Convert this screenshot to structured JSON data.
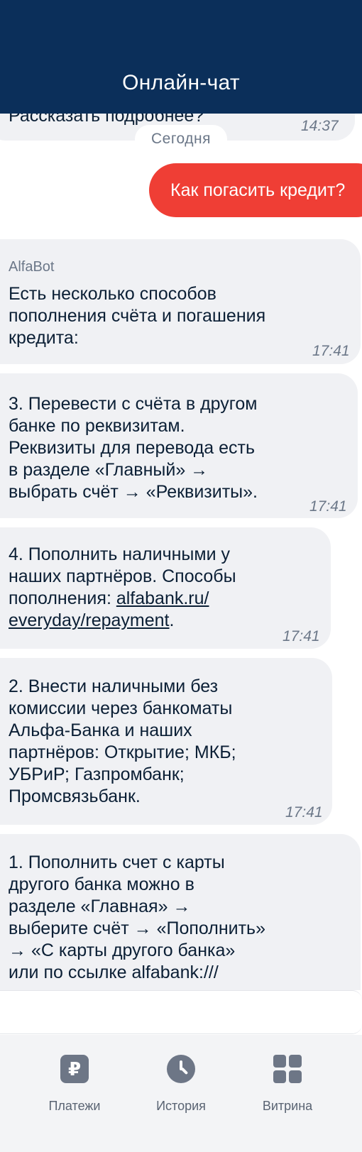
{
  "header": {
    "title": "Онлайн-чат"
  },
  "chat": {
    "prev_message": {
      "text": "Рассказать подробнее?",
      "time": "14:37"
    },
    "date_divider": "Сегодня",
    "user_message": {
      "text": "Как погасить кредит?"
    },
    "bot_messages": [
      {
        "sender": "AlfaBot",
        "text": "Есть несколько способов\nпополнения счёта и погашения\nкредита:",
        "time": "17:41"
      },
      {
        "text": "3. Перевести с счёта в другом\nбанке по реквизитам.\nРеквизиты для перевода есть\nв разделе «Главный» →\nвыбрать счёт → «Реквизиты».",
        "time": "17:41"
      },
      {
        "text_before_link": "4. Пополнить наличными у\nнаших партнёров. Способы\nпополнения: ",
        "link_line1": "alfabank.ru/",
        "link_line2": "everyday/repayment",
        "text_after_link": ".",
        "time": "17:41"
      },
      {
        "text": "2. Внести наличными без\nкомиссии через банкоматы\nАльфа-Банка и наших\nпартнёров: Открытие; МКБ;\nУБРиР; Газпромбанк;\nПромсвязьбанк.",
        "time": "17:41"
      },
      {
        "text": "1. Пополнить счет с карты\nдругого банка можно в\nразделе «Главная» →\nвыберите счёт → «Пополнить»\n→ «С карты другого банка»\nили по ссылке alfabank:///"
      }
    ]
  },
  "tabbar": {
    "items": [
      {
        "label": "Платежи",
        "icon": "ruble-icon",
        "glyph": "₽"
      },
      {
        "label": "История",
        "icon": "clock-icon"
      },
      {
        "label": "Витрина",
        "icon": "grid-icon"
      }
    ]
  },
  "colors": {
    "header_bg": "#0b2f5a",
    "user_bubble": "#ef3e35",
    "bot_bubble": "#f0f1f4"
  }
}
